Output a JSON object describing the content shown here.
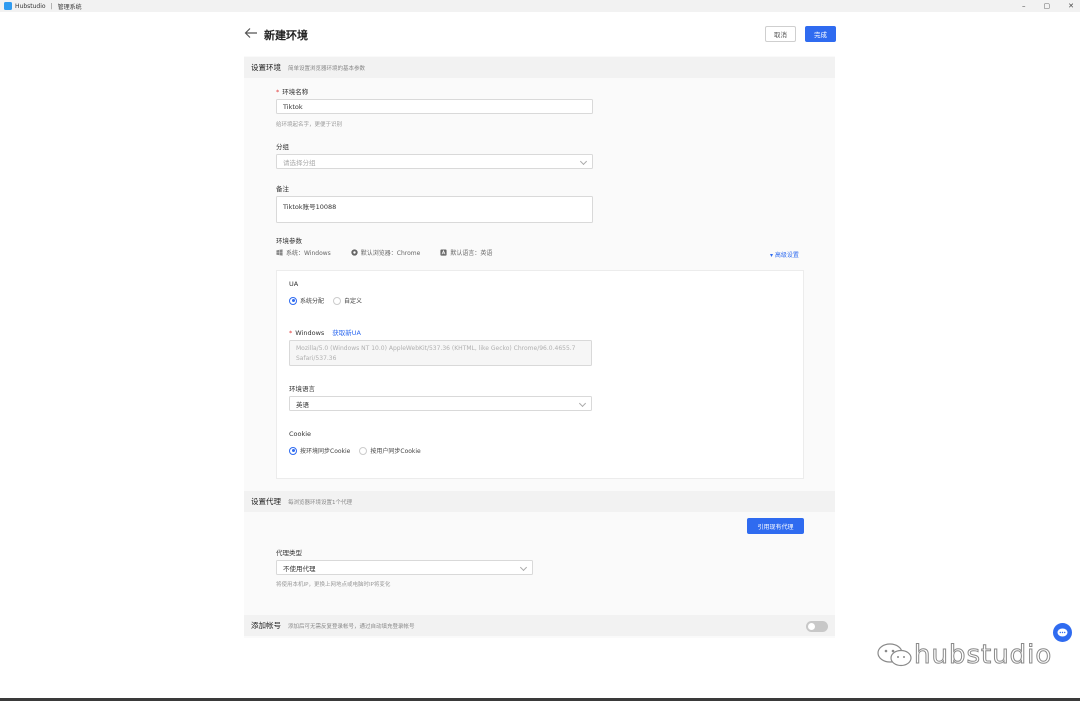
{
  "titlebar": {
    "app_name": "Hubstudio",
    "separator": "|",
    "menu": "管理系统",
    "minimize": "–",
    "restore": "▢",
    "close": "✕"
  },
  "header": {
    "title": "新建环境",
    "cancel_label": "取消",
    "done_label": "完成"
  },
  "env_section": {
    "title": "设置环境",
    "desc": "简单设置浏览器环境的基本参数",
    "name_label": "环境名称",
    "name_value": "Tiktok",
    "name_hint": "给环境起名字，更便于识别",
    "group_label": "分组",
    "group_placeholder": "请选择分组",
    "note_label": "备注",
    "note_value": "Tiktok账号10088",
    "params_label": "环境参数",
    "params": {
      "system": "系统：Windows",
      "browser": "默认浏览器：Chrome",
      "language": "默认语言：英语"
    },
    "advanced_link": "▾ 高级设置",
    "ua": {
      "label": "UA",
      "option_system": "系统分配",
      "option_custom": "自定义",
      "windows_label": "Windows",
      "get_new_ua": "获取新UA",
      "ua_value": "Mozilla/5.0 (Windows NT 10.0) AppleWebKit/537.36 (KHTML, like Gecko) Chrome/96.0.4655.7 Safari/537.36"
    },
    "lang": {
      "label": "环境语言",
      "value": "英语"
    },
    "cookie": {
      "label": "Cookie",
      "option_env": "按环境同步Cookie",
      "option_user": "按用户同步Cookie"
    }
  },
  "proxy_section": {
    "title": "设置代理",
    "desc": "每浏览器环境设置1个代理",
    "import_button": "引用现有代理",
    "type_label": "代理类型",
    "type_value": "不使用代理",
    "type_hint": "将使用本机IP，更换上网地点或电脑时IP将变化"
  },
  "account_section": {
    "title": "添加帐号",
    "desc": "添加后可无需反复登录帐号，通过自动填充登录帐号"
  },
  "watermark": {
    "text": "hubstudio"
  },
  "colors": {
    "primary": "#2f6bf0",
    "required": "#e03a3a",
    "panel": "#fafafa",
    "section_head": "#f2f2f2"
  }
}
